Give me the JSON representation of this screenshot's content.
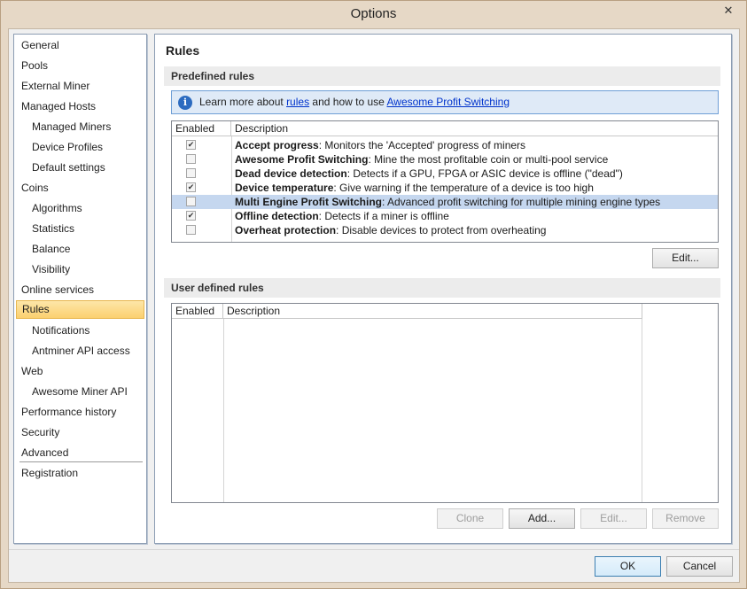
{
  "window": {
    "title": "Options",
    "close_glyph": "✕"
  },
  "sidebar": {
    "items": [
      {
        "label": "General",
        "level": 0
      },
      {
        "label": "Pools",
        "level": 0
      },
      {
        "label": "External Miner",
        "level": 0
      },
      {
        "label": "Managed Hosts",
        "level": 0
      },
      {
        "label": "Managed Miners",
        "level": 1
      },
      {
        "label": "Device Profiles",
        "level": 1
      },
      {
        "label": "Default settings",
        "level": 1
      },
      {
        "label": "Coins",
        "level": 0
      },
      {
        "label": "Algorithms",
        "level": 1
      },
      {
        "label": "Statistics",
        "level": 1
      },
      {
        "label": "Balance",
        "level": 1
      },
      {
        "label": "Visibility",
        "level": 1
      },
      {
        "label": "Online services",
        "level": 0
      },
      {
        "label": "Rules",
        "level": 0,
        "selected": true
      },
      {
        "label": "Notifications",
        "level": 1
      },
      {
        "label": "Antminer API access",
        "level": 1
      },
      {
        "label": "Web",
        "level": 0
      },
      {
        "label": "Awesome Miner API",
        "level": 1
      },
      {
        "label": "Performance history",
        "level": 0
      },
      {
        "label": "Security",
        "level": 0
      },
      {
        "label": "Advanced",
        "level": 0
      },
      {
        "label": "Registration",
        "level": 0
      }
    ]
  },
  "page": {
    "title": "Rules",
    "predefined": {
      "header": "Predefined rules",
      "info": {
        "icon": "info-icon",
        "text_before": "Learn more about ",
        "link1": "rules",
        "text_middle": " and how to use ",
        "link2": "Awesome Profit Switching"
      },
      "columns": [
        "Enabled",
        "Description"
      ],
      "rules": [
        {
          "name": "Accept progress",
          "desc": ": Monitors the 'Accepted' progress of miners",
          "enabled": true,
          "selected": false
        },
        {
          "name": "Awesome Profit Switching",
          "desc": ": Mine the most profitable coin or multi-pool service",
          "enabled": false,
          "selected": false
        },
        {
          "name": "Dead device detection",
          "desc": ": Detects if a GPU, FPGA or ASIC device is offline (\"dead\")",
          "enabled": false,
          "selected": false
        },
        {
          "name": "Device temperature",
          "desc": ": Give warning if the temperature of a device is too high",
          "enabled": true,
          "selected": false
        },
        {
          "name": "Multi Engine Profit Switching",
          "desc": ": Advanced profit switching for multiple mining engine types",
          "enabled": false,
          "selected": true
        },
        {
          "name": "Offline detection",
          "desc": ": Detects if a miner is offline",
          "enabled": true,
          "selected": false
        },
        {
          "name": "Overheat protection",
          "desc": ": Disable devices to protect from overheating",
          "enabled": false,
          "selected": false
        }
      ],
      "edit_label": "Edit..."
    },
    "user_defined": {
      "header": "User defined rules",
      "columns": [
        "Enabled",
        "Description"
      ],
      "buttons": {
        "clone": "Clone",
        "add": "Add...",
        "edit": "Edit...",
        "remove": "Remove"
      }
    }
  },
  "footer": {
    "ok": "OK",
    "cancel": "Cancel"
  },
  "colors": {
    "window_border": "#e6d8c6",
    "selection_highlight": "#fbd06f",
    "grid_selection": "#c5d7ef",
    "info_bar": "#dfeaf7"
  }
}
